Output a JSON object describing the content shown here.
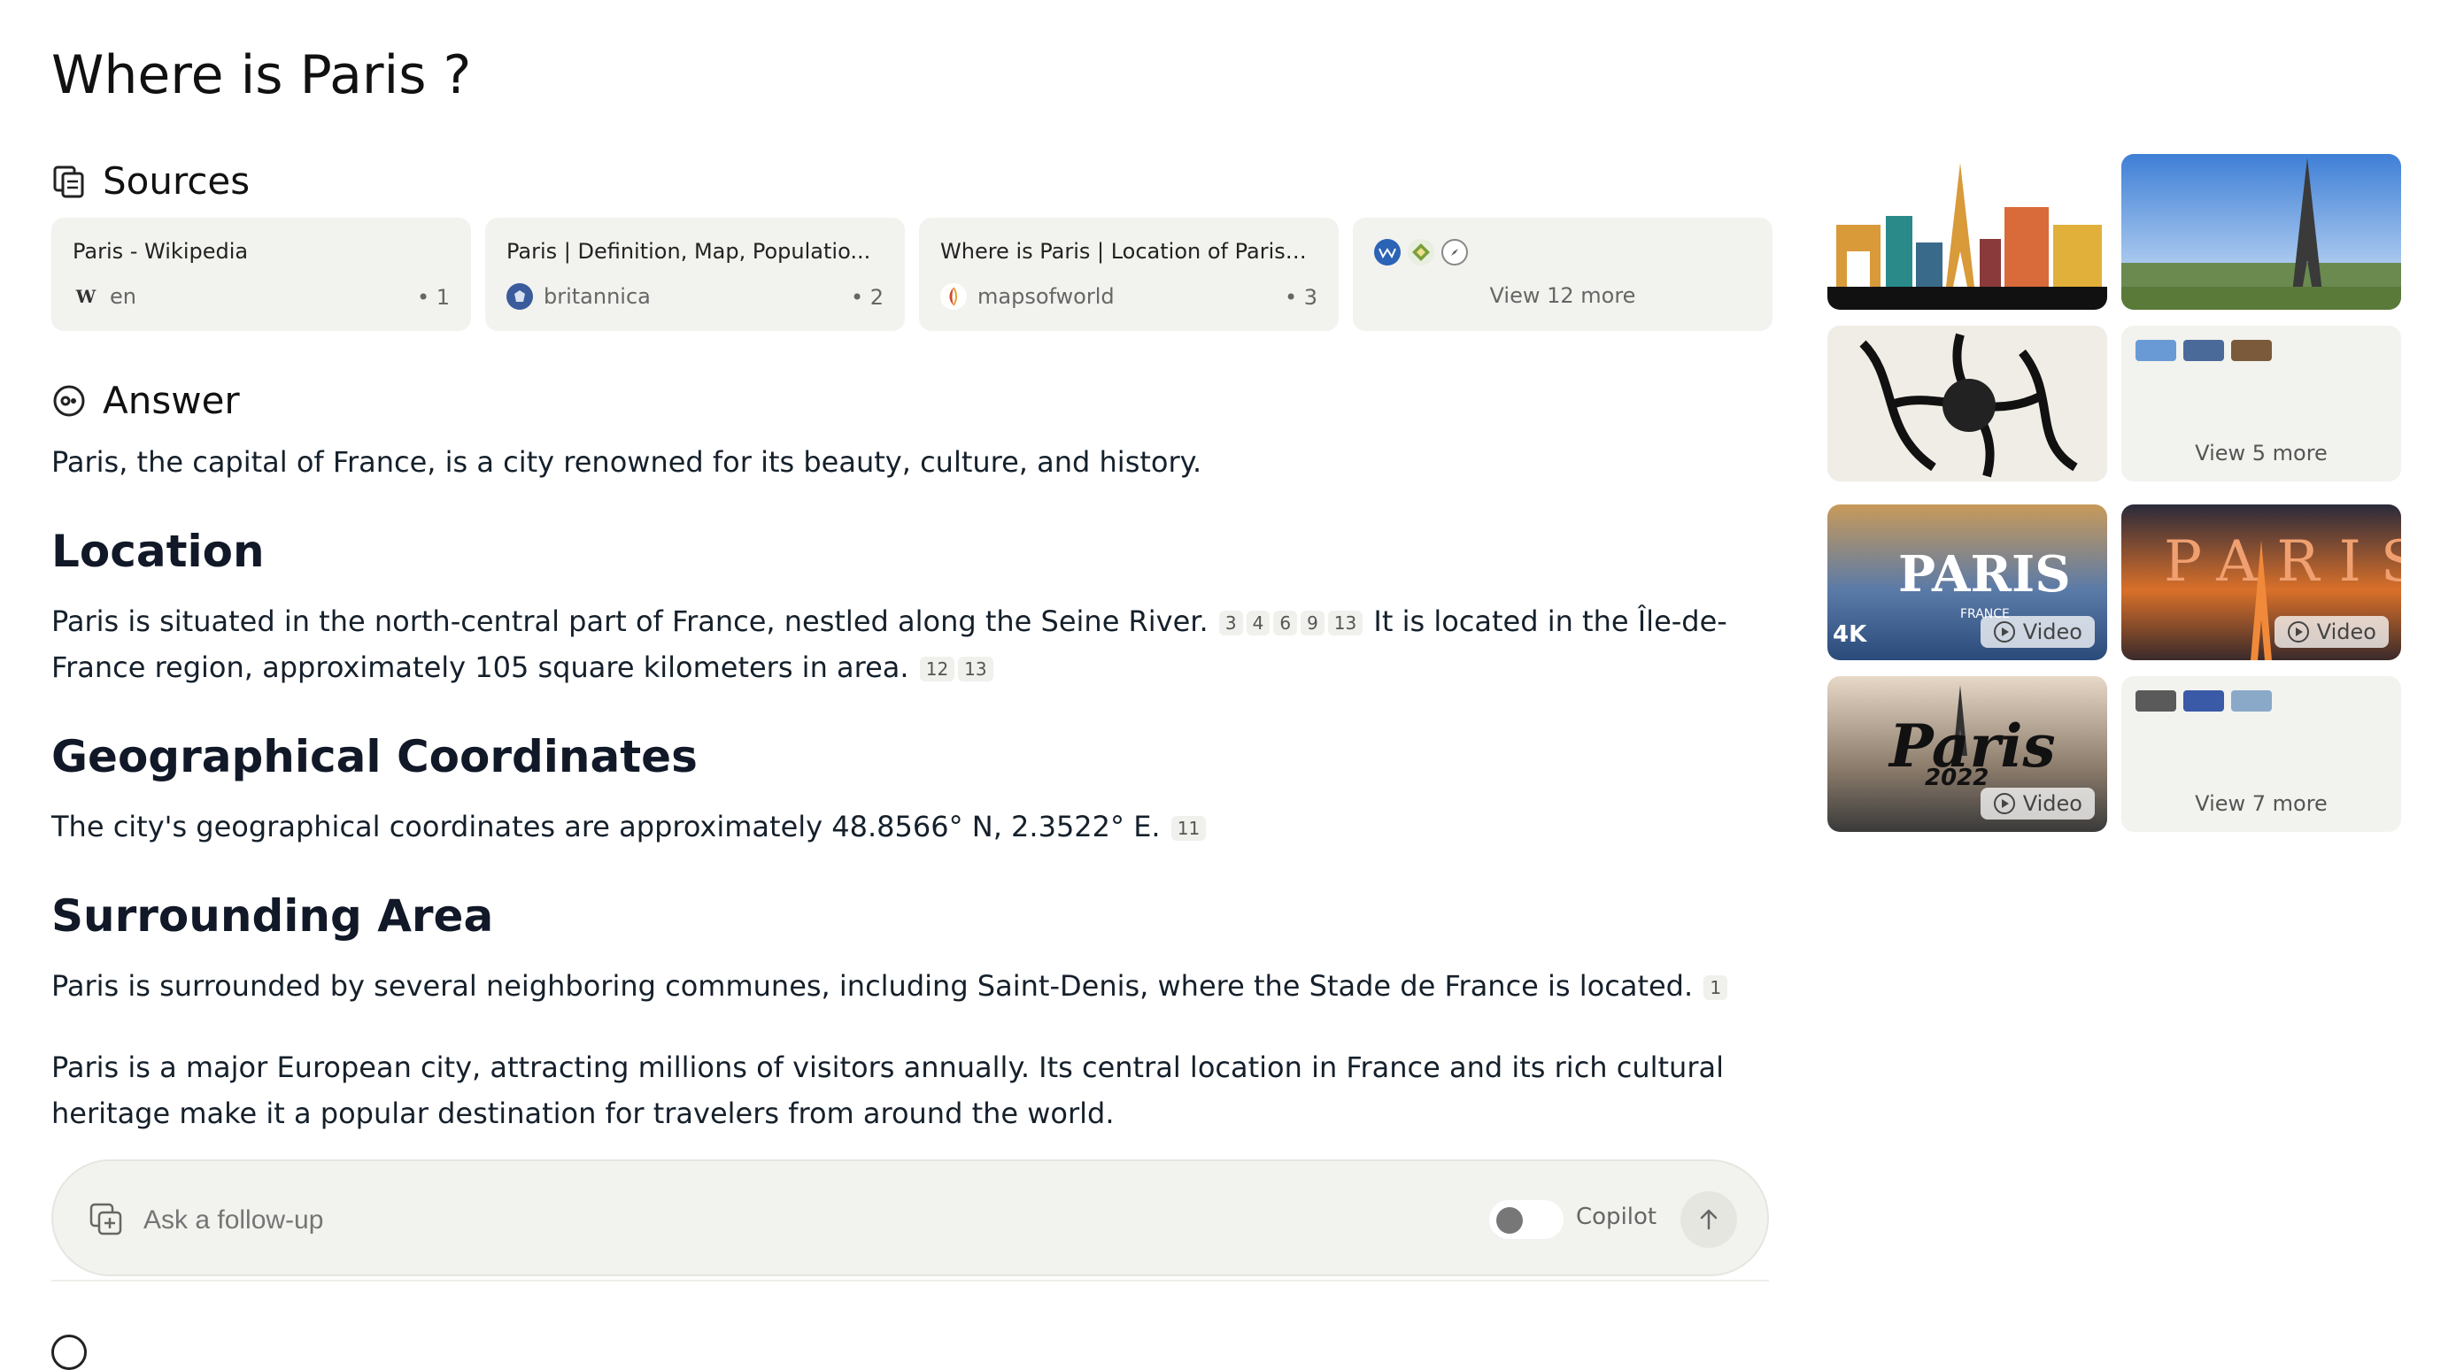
{
  "query": {
    "title": "Where is Paris ?"
  },
  "sources": {
    "heading": "Sources",
    "cards": [
      {
        "title": "Paris - Wikipedia",
        "site": "en",
        "index": "• 1",
        "icon": "wikipedia-icon"
      },
      {
        "title": "Paris | Definition, Map, Populatio...",
        "site": "britannica",
        "index": "• 2",
        "icon": "britannica-icon"
      },
      {
        "title": "Where is Paris | Location of Paris ...",
        "site": "mapsofworld",
        "index": "• 3",
        "icon": "mapsofworld-icon"
      }
    ],
    "more_label": "View 12 more"
  },
  "answer": {
    "heading": "Answer",
    "intro": "Paris, the capital of France, is a city renowned for its beauty, culture, and history.",
    "sections": [
      {
        "heading": "Location",
        "text1": "Paris is situated in the north-central part of France, nestled along the Seine River.",
        "cites1": [
          "3",
          "4",
          "6",
          "9",
          "13"
        ],
        "text2": "It is located in the Île-de-France region, approximately 105 square kilometers in area.",
        "cites2": [
          "12",
          "13"
        ]
      },
      {
        "heading": "Geographical Coordinates",
        "text1": "The city's geographical coordinates are approximately 48.8566° N, 2.3522° E.",
        "cites1": [
          "11"
        ]
      },
      {
        "heading": "Surrounding Area",
        "text1": "Paris is surrounded by several neighboring communes, including Saint-Denis, where the Stade de France is located.",
        "cites1": [
          "1"
        ]
      }
    ],
    "closing": "Paris is a major European city, attracting millions of visitors annually. Its central location in France and its rich cultural heritage make it a popular destination for travelers from around the world."
  },
  "followup": {
    "placeholder": "Ask a follow-up",
    "mode_label": "Copilot"
  },
  "media": {
    "video_label": "Video",
    "view_more_images": "View 5 more",
    "view_more_videos": "View 7 more",
    "video_titles": [
      "PARIS",
      "PARIS",
      "Paris"
    ],
    "video_sub": [
      "4K",
      "FRANCE",
      "2022"
    ]
  },
  "colors": {
    "background": "#ffffff",
    "card": "#f2f2ee",
    "text": "#15202b",
    "heading": "#111827"
  }
}
